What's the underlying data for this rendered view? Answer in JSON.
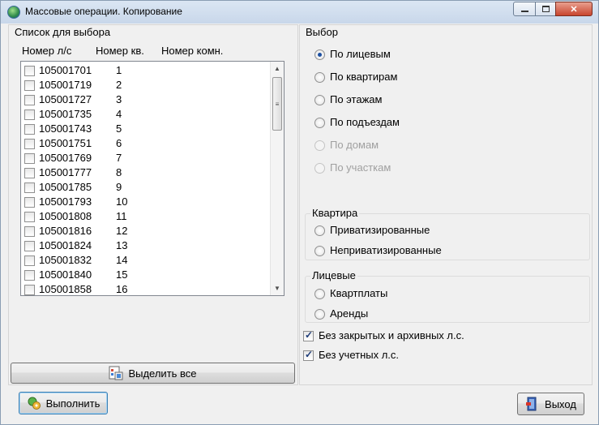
{
  "window": {
    "title": "Массовые операции. Копирование"
  },
  "left_panel": {
    "title": "Список для выбора",
    "columns": [
      "Номер л/с",
      "Номер кв.",
      "Номер комн."
    ],
    "rows": [
      {
        "account": "105001701",
        "apartment": "1"
      },
      {
        "account": "105001719",
        "apartment": "2"
      },
      {
        "account": "105001727",
        "apartment": "3"
      },
      {
        "account": "105001735",
        "apartment": "4"
      },
      {
        "account": "105001743",
        "apartment": "5"
      },
      {
        "account": "105001751",
        "apartment": "6"
      },
      {
        "account": "105001769",
        "apartment": "7"
      },
      {
        "account": "105001777",
        "apartment": "8"
      },
      {
        "account": "105001785",
        "apartment": "9"
      },
      {
        "account": "105001793",
        "apartment": "10"
      },
      {
        "account": "105001808",
        "apartment": "11"
      },
      {
        "account": "105001816",
        "apartment": "12"
      },
      {
        "account": "105001824",
        "apartment": "13"
      },
      {
        "account": "105001832",
        "apartment": "14"
      },
      {
        "account": "105001840",
        "apartment": "15"
      },
      {
        "account": "105001858",
        "apartment": "16"
      }
    ],
    "select_all_label": "Выделить все"
  },
  "right_panel": {
    "title": "Выбор",
    "options": [
      {
        "label": "По лицевым",
        "selected": true,
        "enabled": true
      },
      {
        "label": "По квартирам",
        "selected": false,
        "enabled": true
      },
      {
        "label": "По этажам",
        "selected": false,
        "enabled": true
      },
      {
        "label": "По подъездам",
        "selected": false,
        "enabled": true
      },
      {
        "label": "По домам",
        "selected": false,
        "enabled": false
      },
      {
        "label": "По участкам",
        "selected": false,
        "enabled": false
      }
    ],
    "apartment_group": {
      "title": "Квартира",
      "options": [
        "Приватизированные",
        "Неприватизированные"
      ]
    },
    "accounts_group": {
      "title": "Лицевые",
      "options": [
        "Квартплаты",
        "Аренды"
      ]
    },
    "checkboxes": [
      {
        "label": "Без закрытых и архивных л.с.",
        "checked": true
      },
      {
        "label": "Без учетных л.с.",
        "checked": true
      }
    ]
  },
  "footer": {
    "execute_label": "Выполнить",
    "exit_label": "Выход"
  }
}
